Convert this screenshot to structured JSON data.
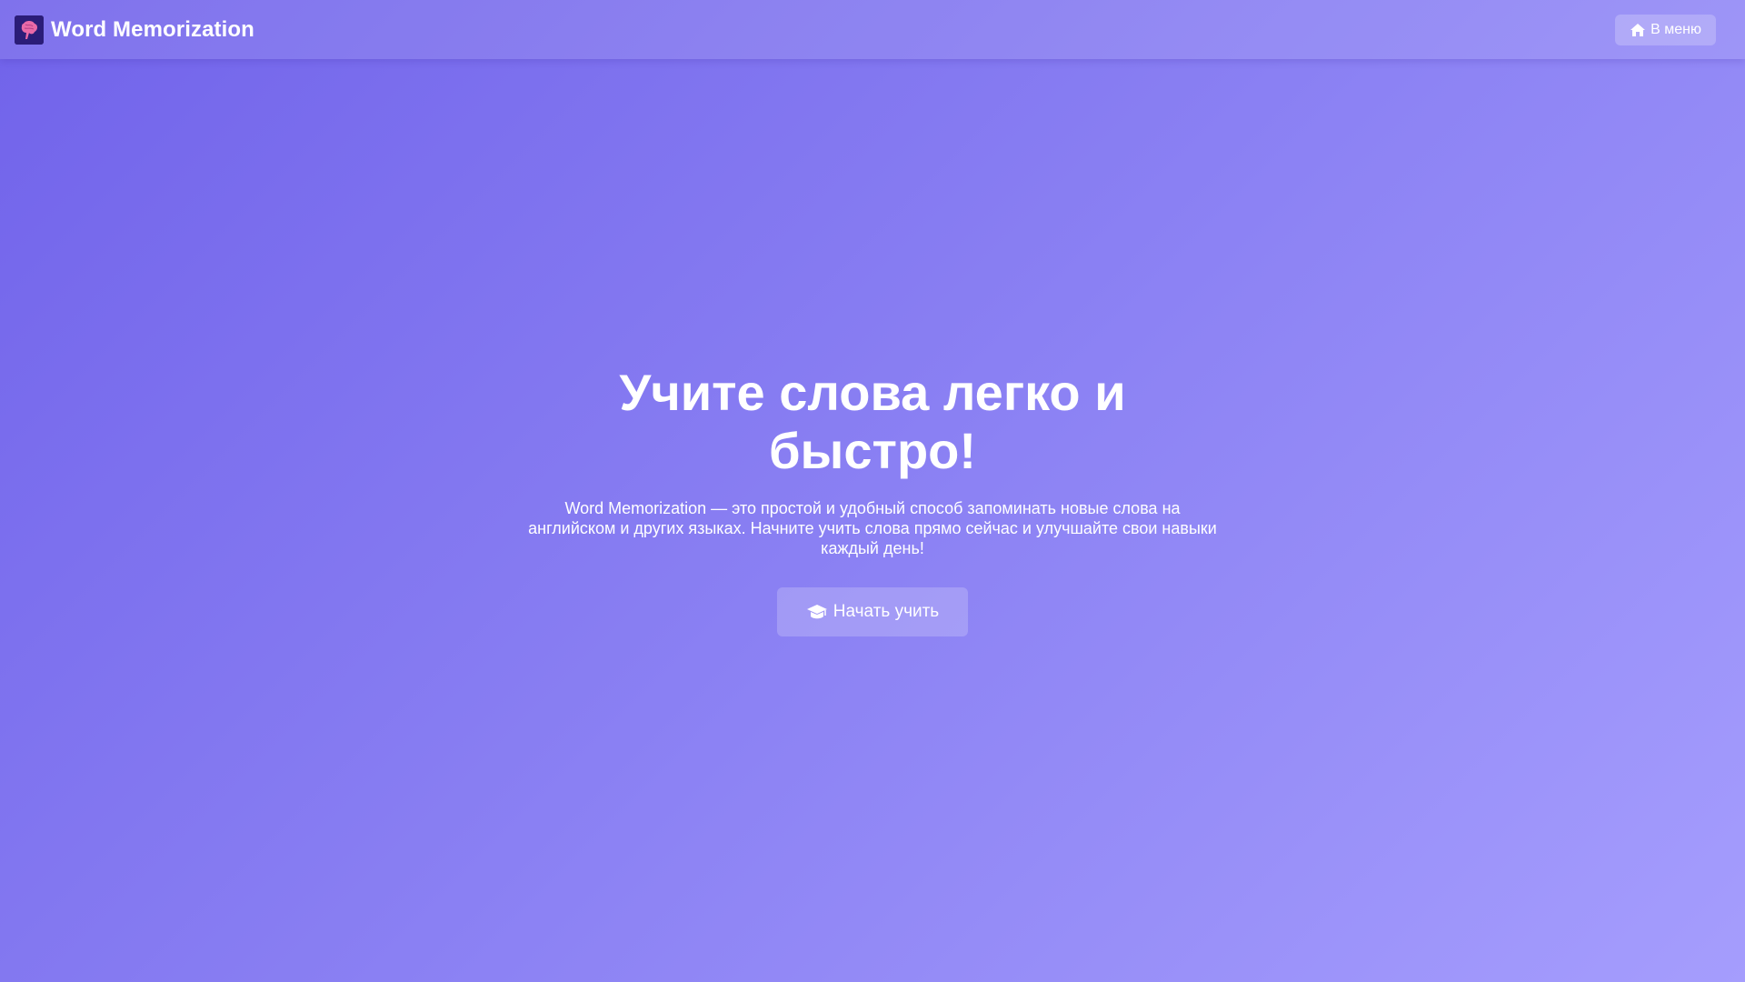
{
  "header": {
    "brand_title": "Word Memorization",
    "logo_icon": "brain-logo-icon",
    "menu_button": {
      "label": "В меню",
      "icon": "home-icon"
    }
  },
  "hero": {
    "title": "Учите слова легко и быстро!",
    "description": "Word Memorization — это простой и удобный способ запоминать новые слова на английском и других языках. Начните учить слова прямо сейчас и улучшайте свои навыки каждый день!",
    "start_button": {
      "label": "Начать учить",
      "icon": "graduation-cap-icon"
    }
  },
  "colors": {
    "background_start": "#7163ea",
    "background_end": "#a59dfd",
    "text": "#ffffff"
  }
}
